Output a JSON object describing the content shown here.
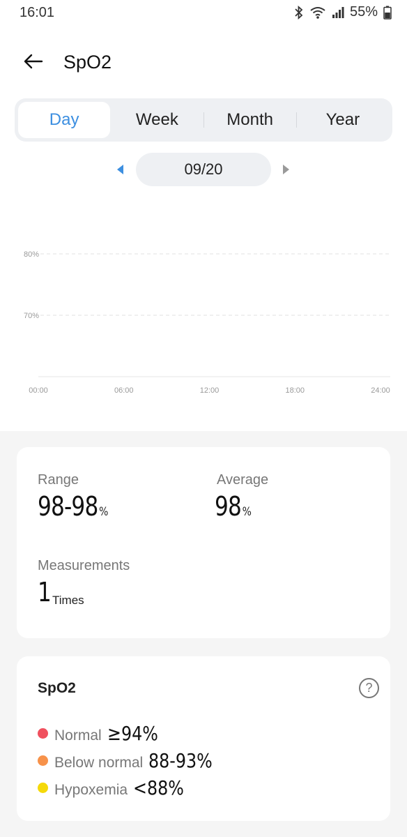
{
  "status_bar": {
    "time": "16:01",
    "battery": "55%",
    "icons": [
      "bluetooth-icon",
      "wifi-icon",
      "signal-icon",
      "battery-icon"
    ]
  },
  "header": {
    "title": "SpO2"
  },
  "tabs": [
    {
      "label": "Day",
      "active": true
    },
    {
      "label": "Week",
      "active": false
    },
    {
      "label": "Month",
      "active": false
    },
    {
      "label": "Year",
      "active": false
    }
  ],
  "date_selector": {
    "date": "09/20"
  },
  "chart_data": {
    "type": "scatter",
    "series": [],
    "y_ticks": [
      "80%",
      "70%"
    ],
    "x_ticks": [
      "00:00",
      "06:00",
      "12:00",
      "18:00",
      "24:00"
    ],
    "grid": true
  },
  "stats": {
    "range_label": "Range",
    "range_value": "98-98",
    "range_unit": "%",
    "average_label": "Average",
    "average_value": "98",
    "average_unit": "%",
    "measurements_label": "Measurements",
    "measurements_value": "1",
    "measurements_unit": "Times"
  },
  "legend": {
    "title": "SpO2",
    "help": "?",
    "items": [
      {
        "label": "Normal",
        "value": "≥94%",
        "color": "#f0505e"
      },
      {
        "label": "Below normal",
        "value": "88-93%",
        "color": "#f7924a"
      },
      {
        "label": "Hypoxemia",
        "value": "<88%",
        "color": "#f5d90a"
      }
    ]
  },
  "colors": {
    "accent": "#3d8fe0"
  }
}
